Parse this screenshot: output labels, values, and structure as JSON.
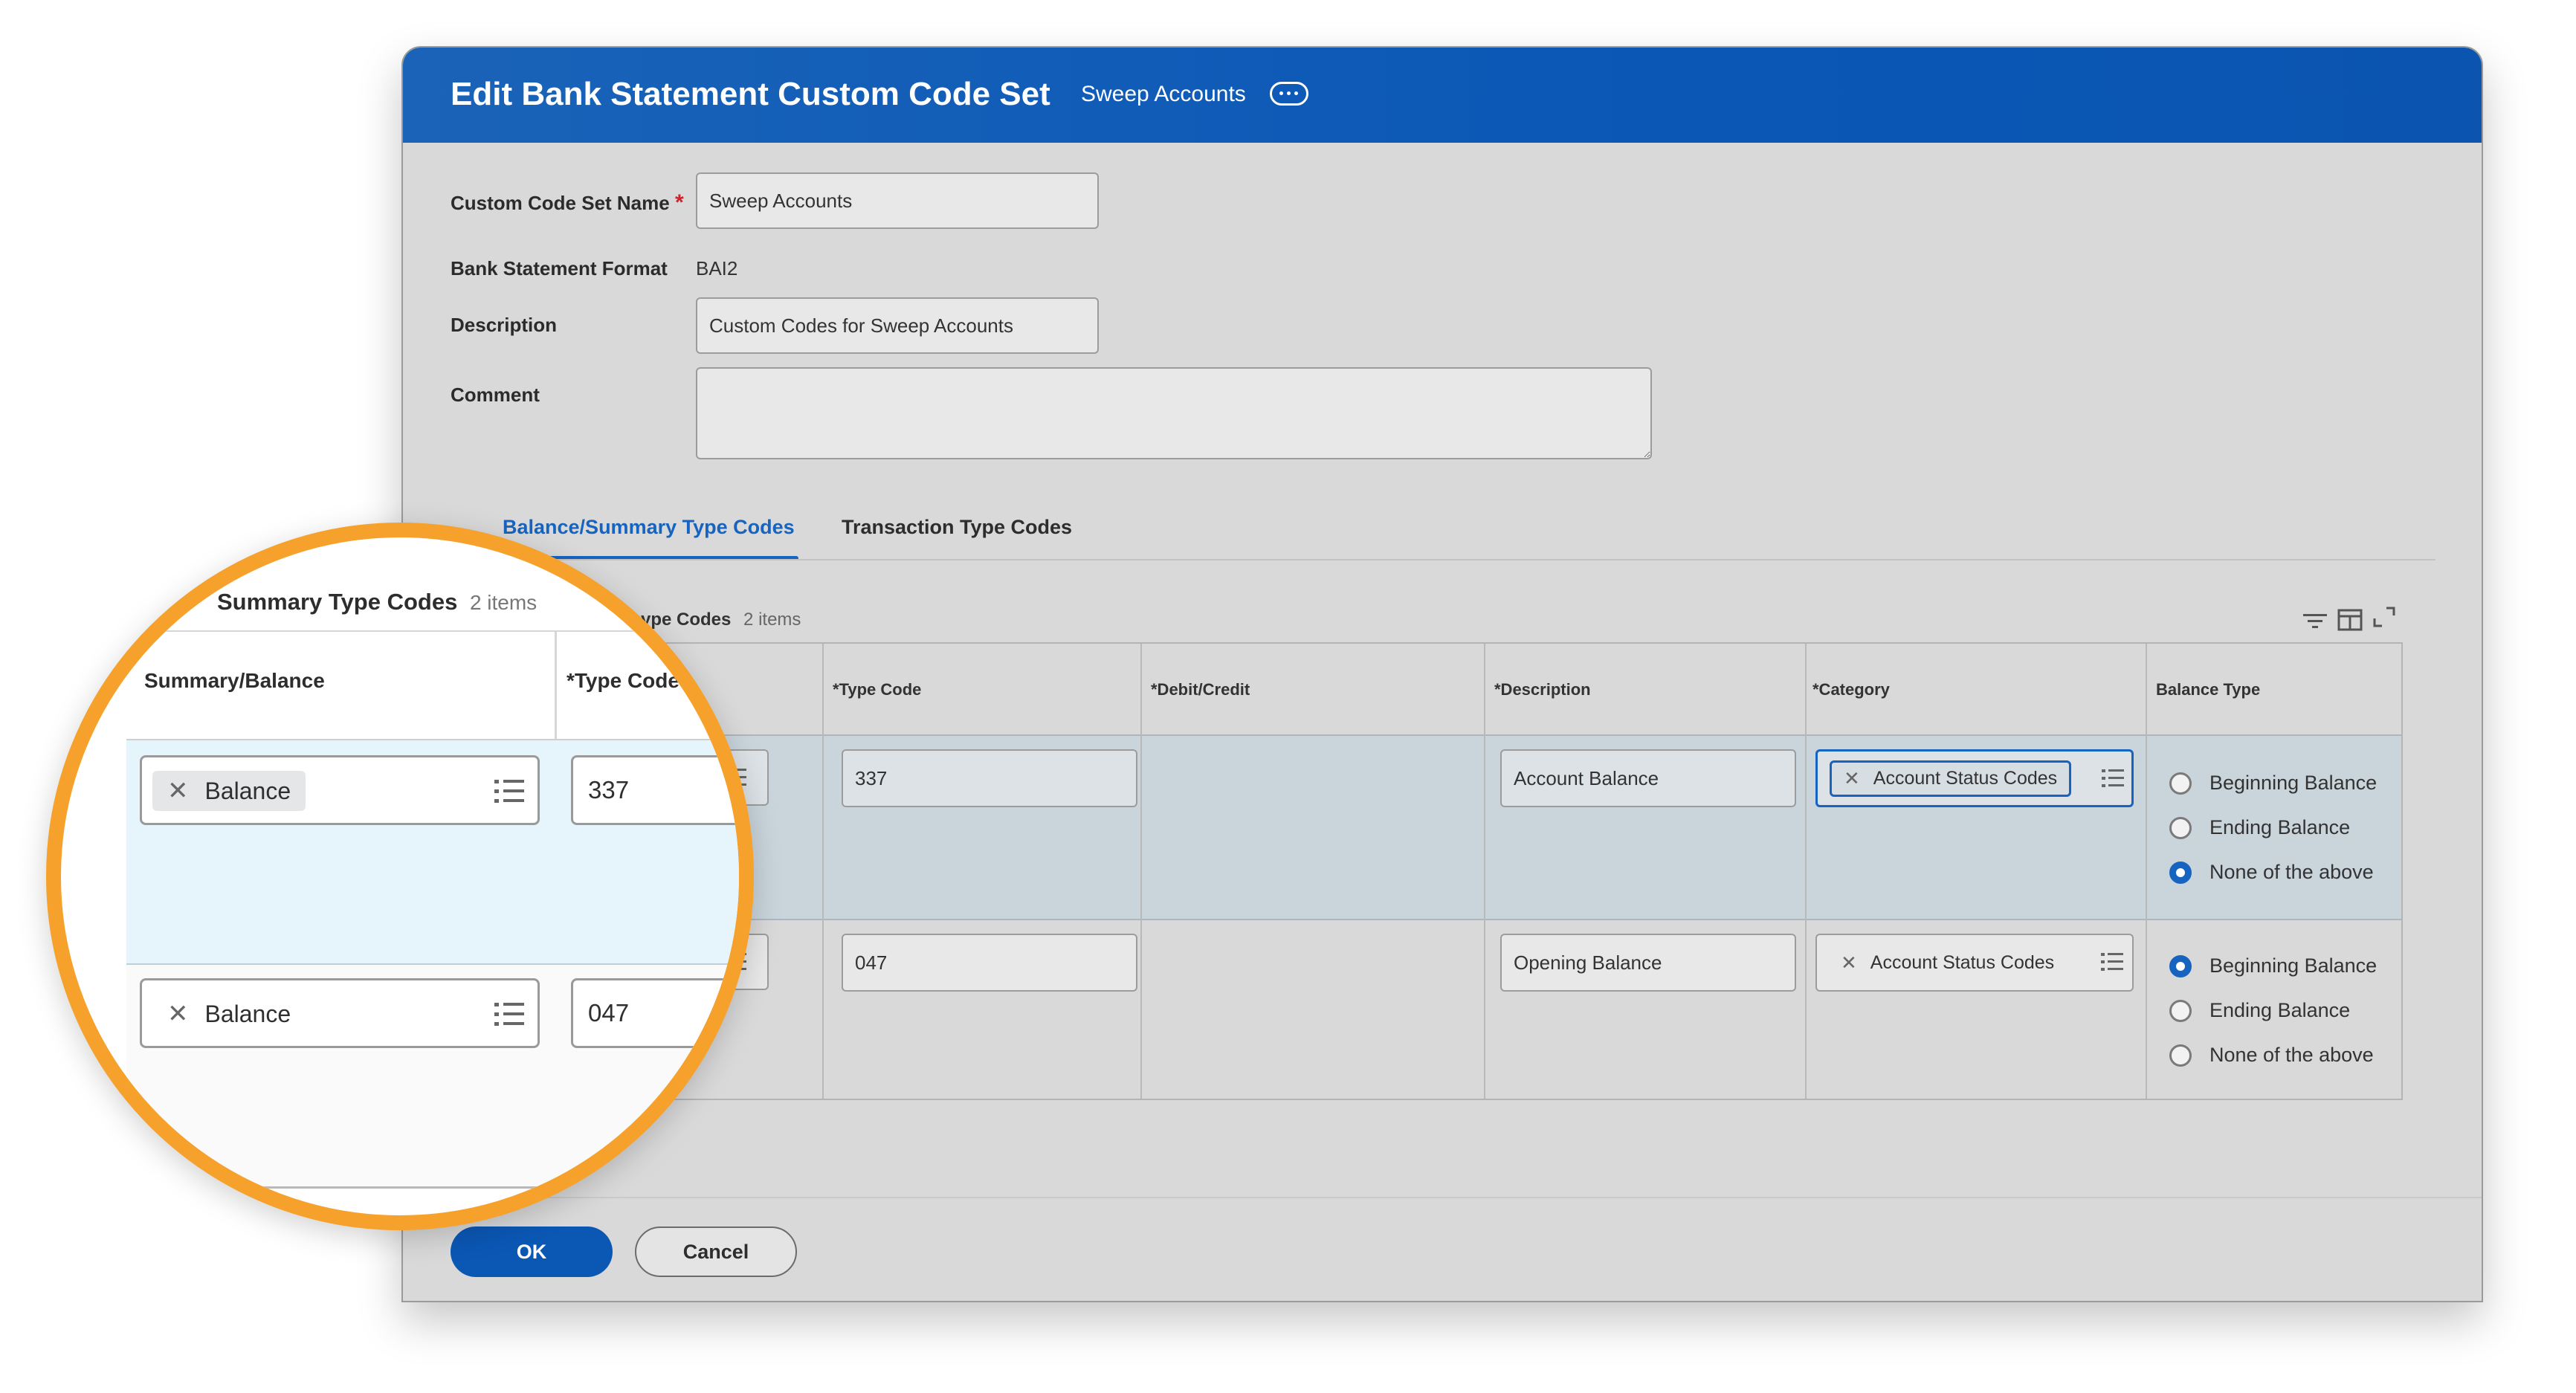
{
  "header": {
    "title": "Edit Bank Statement Custom Code Set",
    "subtitle": "Sweep Accounts"
  },
  "form": {
    "name_label": "Custom Code Set Name",
    "name_value": "Sweep Accounts",
    "format_label": "Bank Statement Format",
    "format_value": "BAI2",
    "description_label": "Description",
    "description_value": "Custom Codes for Sweep Accounts",
    "comment_label": "Comment",
    "comment_value": ""
  },
  "tabs": [
    "Balance/Summary Type Codes",
    "Transaction Type Codes"
  ],
  "grid": {
    "title_partial": "ype Codes",
    "count": "2 items",
    "columns": [
      "*Type Code",
      "*Debit/Credit",
      "*Description",
      "*Category",
      "Balance Type"
    ],
    "rows": [
      {
        "type_code": "337",
        "description": "Account Balance",
        "category": "Account Status Codes",
        "balance_type_selected": "None of the above"
      },
      {
        "type_code": "047",
        "description": "Opening Balance",
        "category": "Account Status Codes",
        "balance_type_selected": "Beginning Balance"
      }
    ],
    "balance_type_options": [
      "Beginning Balance",
      "Ending Balance",
      "None of the above"
    ]
  },
  "zoom": {
    "title": "Summary Type Codes",
    "count": "2 items",
    "col1": "Summary/Balance",
    "col2": "*Type Code",
    "rows": [
      {
        "summary": "Balance",
        "type_code": "337"
      },
      {
        "summary": "Balance",
        "type_code": "047"
      }
    ]
  },
  "buttons": {
    "ok": "OK",
    "cancel": "Cancel"
  },
  "colors": {
    "header_blue": "#0b57b4",
    "accent": "#1664c0",
    "zoom_ring": "#f6a12c",
    "required": "#d0212d"
  }
}
